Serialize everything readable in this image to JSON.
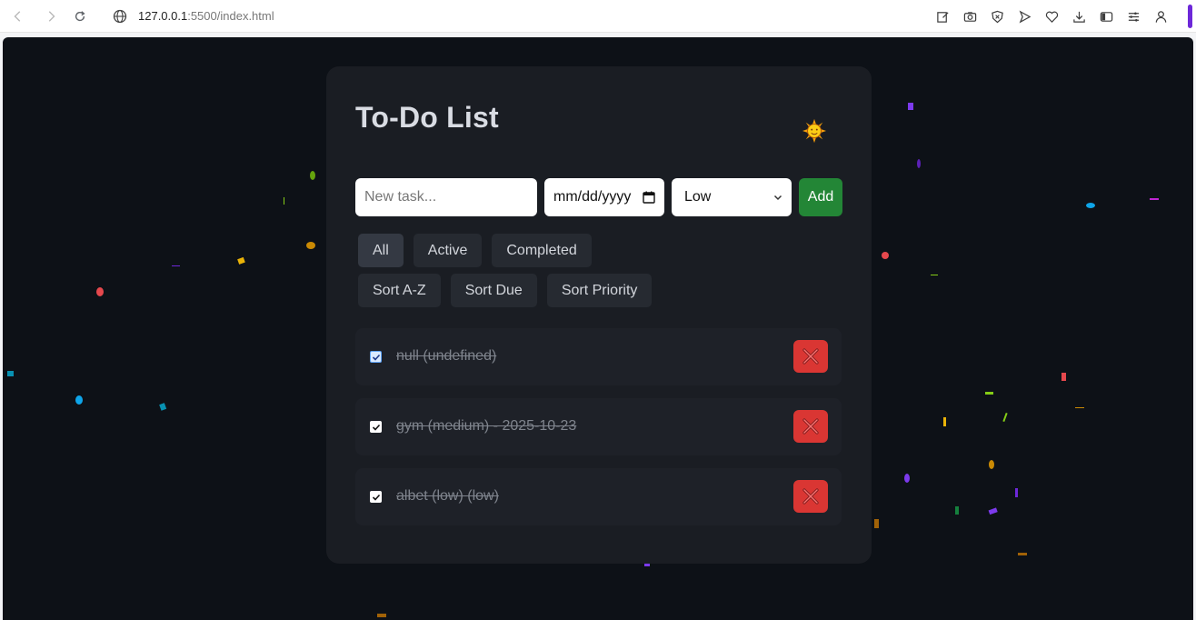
{
  "browser": {
    "url_host": "127.0.0.1",
    "url_rest": ":5500/index.html"
  },
  "app": {
    "title": "To-Do List",
    "theme_icon": "sun-emoji",
    "theme_glyph": "🌞"
  },
  "form": {
    "task_placeholder": "New task...",
    "date_placeholder": "mm/dd/yyyy",
    "priority_selected": "Low",
    "add_label": "Add"
  },
  "filters": [
    {
      "label": "All",
      "active": true
    },
    {
      "label": "Active",
      "active": false
    },
    {
      "label": "Completed",
      "active": false
    }
  ],
  "sorts": [
    {
      "label": "Sort A-Z"
    },
    {
      "label": "Sort Due"
    },
    {
      "label": "Sort Priority"
    }
  ],
  "tasks": [
    {
      "text": "null (undefined)",
      "completed": true
    },
    {
      "text": "gym (medium) - 2025-10-23",
      "completed": true
    },
    {
      "text": "albet (low) (low)",
      "completed": true
    }
  ],
  "colors": {
    "page_bg": "#0d1117",
    "card_bg": "#1a1d23",
    "add_button": "#238636",
    "delete_button": "#da3633"
  }
}
